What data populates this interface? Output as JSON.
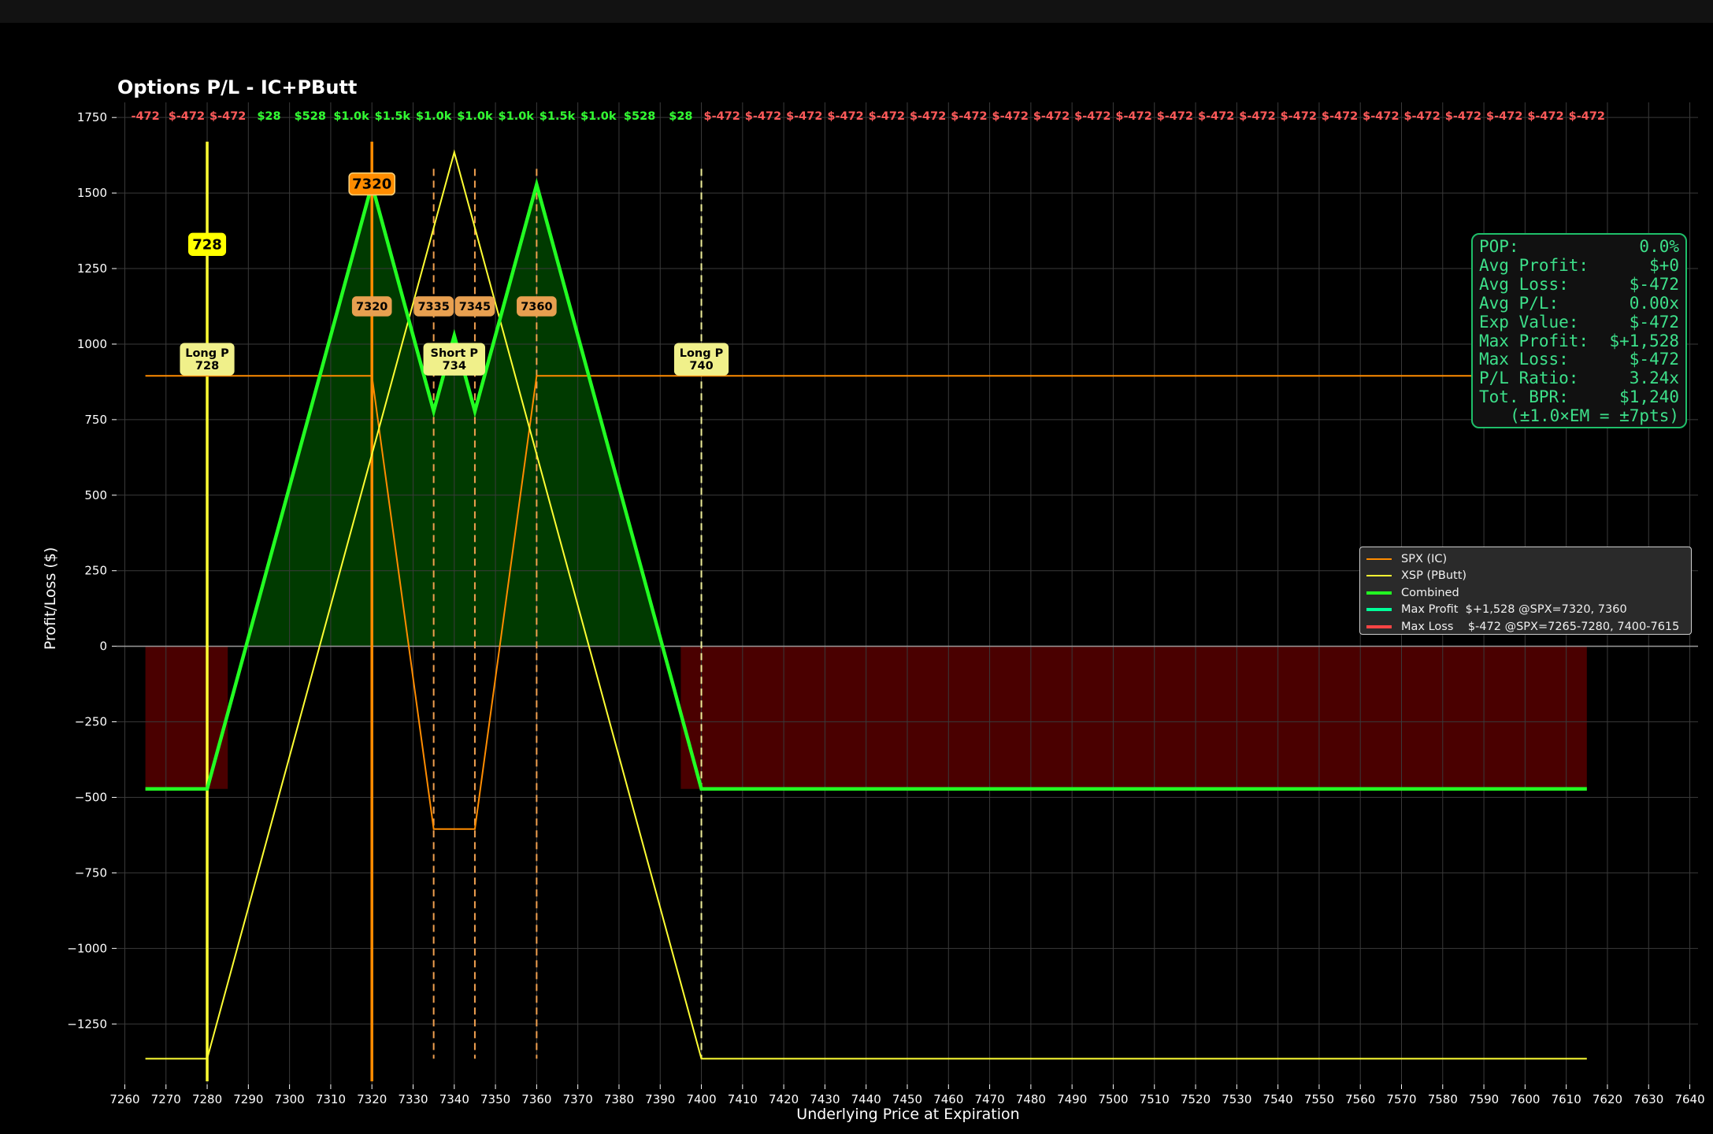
{
  "title": "Options P/L - IC+PButt",
  "chart_data": {
    "type": "line",
    "title": "Options P/L - IC+PButt",
    "xlabel": "Underlying Price at Expiration",
    "ylabel": "Profit/Loss ($)",
    "xlim": [
      7258,
      7642
    ],
    "ylim": [
      -1450,
      1800
    ],
    "xticks": [
      7260,
      7270,
      7280,
      7290,
      7300,
      7310,
      7320,
      7330,
      7340,
      7350,
      7360,
      7370,
      7380,
      7390,
      7400,
      7410,
      7420,
      7430,
      7440,
      7450,
      7460,
      7470,
      7480,
      7490,
      7500,
      7510,
      7520,
      7530,
      7540,
      7550,
      7560,
      7570,
      7580,
      7590,
      7600,
      7610,
      7620,
      7630,
      7640
    ],
    "xtick_labels": [
      "7260",
      "7270",
      "7280",
      "7290",
      "7300",
      "7310",
      "7320",
      "7330",
      "7340",
      "7350",
      "7360",
      "7370",
      "7380",
      "7390",
      "7400",
      "7410",
      "7420",
      "7430",
      "7440",
      "7450",
      "7460",
      "7470",
      "7480",
      "7490",
      "7500",
      "7510",
      "7520",
      "7530",
      "7540",
      "7550",
      "7560",
      "7570",
      "7580",
      "7590",
      "7600",
      "7610",
      "7620",
      "7630",
      "7640"
    ],
    "yticks": [
      -1250,
      -1000,
      -750,
      -500,
      -250,
      0,
      250,
      500,
      750,
      1000,
      1250,
      1500,
      1750
    ],
    "ytick_labels": [
      "−1250",
      "−1000",
      "−750",
      "−500",
      "−250",
      "0",
      "250",
      "500",
      "750",
      "1000",
      "1250",
      "1500",
      "1750"
    ],
    "grid": true,
    "legend_position": "right",
    "series": [
      {
        "name": "SPX (IC)",
        "color": "#ff8c00",
        "x": [
          7265,
          7320,
          7335,
          7345,
          7360,
          7615
        ],
        "y": [
          895,
          895,
          -605,
          -605,
          895,
          895
        ]
      },
      {
        "name": "XSP (PButt)",
        "color": "#ffff33",
        "x": [
          7265,
          7280,
          7340,
          7400,
          7615
        ],
        "y": [
          -1365,
          -1365,
          1635,
          -1365,
          -1365
        ]
      },
      {
        "name": "Combined",
        "color": "#22ff22",
        "x": [
          7265,
          7280,
          7320,
          7335,
          7340,
          7345,
          7360,
          7400,
          7615
        ],
        "y": [
          -472,
          -472,
          1528,
          778,
          1028,
          778,
          1528,
          -472,
          -472
        ]
      }
    ],
    "legend_entries": [
      {
        "label": "SPX (IC)",
        "color": "#ff8c00"
      },
      {
        "label": "XSP (PButt)",
        "color": "#ffff33"
      },
      {
        "label": "Combined",
        "color": "#22ff22"
      },
      {
        "label": "Max Profit  $+1,528 @SPX=7320, 7360",
        "color": "#00ff99"
      },
      {
        "label": "Max Loss    $-472 @SPX=7265-7280, 7400-7615",
        "color": "#ff4444"
      }
    ],
    "loss_zones": [
      [
        7265,
        7285
      ],
      [
        7395,
        7615
      ]
    ],
    "top_pl_labels": [
      {
        "x": 7265,
        "text": "-472",
        "color": "#ff5a5a"
      },
      {
        "x": 7275,
        "text": "$-472",
        "color": "#ff5a5a"
      },
      {
        "x": 7285,
        "text": "$-472",
        "color": "#ff5a5a"
      },
      {
        "x": 7295,
        "text": "$28",
        "color": "#33ff33"
      },
      {
        "x": 7305,
        "text": "$528",
        "color": "#33ff33"
      },
      {
        "x": 7315,
        "text": "$1.0k",
        "color": "#33ff33"
      },
      {
        "x": 7325,
        "text": "$1.5k",
        "color": "#33ff33"
      },
      {
        "x": 7335,
        "text": "$1.0k",
        "color": "#33ff33"
      },
      {
        "x": 7345,
        "text": "$1.0k",
        "color": "#33ff33"
      },
      {
        "x": 7355,
        "text": "$1.0k",
        "color": "#33ff33"
      },
      {
        "x": 7365,
        "text": "$1.5k",
        "color": "#33ff33"
      },
      {
        "x": 7375,
        "text": "$1.0k",
        "color": "#33ff33"
      },
      {
        "x": 7385,
        "text": "$528",
        "color": "#33ff33"
      },
      {
        "x": 7395,
        "text": "$28",
        "color": "#33ff33"
      },
      {
        "x": 7405,
        "text": "$-472",
        "color": "#ff5a5a"
      },
      {
        "x": 7415,
        "text": "$-472",
        "color": "#ff5a5a"
      },
      {
        "x": 7425,
        "text": "$-472",
        "color": "#ff5a5a"
      },
      {
        "x": 7435,
        "text": "$-472",
        "color": "#ff5a5a"
      },
      {
        "x": 7445,
        "text": "$-472",
        "color": "#ff5a5a"
      },
      {
        "x": 7455,
        "text": "$-472",
        "color": "#ff5a5a"
      },
      {
        "x": 7465,
        "text": "$-472",
        "color": "#ff5a5a"
      },
      {
        "x": 7475,
        "text": "$-472",
        "color": "#ff5a5a"
      },
      {
        "x": 7485,
        "text": "$-472",
        "color": "#ff5a5a"
      },
      {
        "x": 7495,
        "text": "$-472",
        "color": "#ff5a5a"
      },
      {
        "x": 7505,
        "text": "$-472",
        "color": "#ff5a5a"
      },
      {
        "x": 7515,
        "text": "$-472",
        "color": "#ff5a5a"
      },
      {
        "x": 7525,
        "text": "$-472",
        "color": "#ff5a5a"
      },
      {
        "x": 7535,
        "text": "$-472",
        "color": "#ff5a5a"
      },
      {
        "x": 7545,
        "text": "$-472",
        "color": "#ff5a5a"
      },
      {
        "x": 7555,
        "text": "$-472",
        "color": "#ff5a5a"
      },
      {
        "x": 7565,
        "text": "$-472",
        "color": "#ff5a5a"
      },
      {
        "x": 7575,
        "text": "$-472",
        "color": "#ff5a5a"
      },
      {
        "x": 7585,
        "text": "$-472",
        "color": "#ff5a5a"
      },
      {
        "x": 7595,
        "text": "$-472",
        "color": "#ff5a5a"
      },
      {
        "x": 7605,
        "text": "$-472",
        "color": "#ff5a5a"
      },
      {
        "x": 7615,
        "text": "$-472",
        "color": "#ff5a5a"
      }
    ],
    "strike_lines": [
      {
        "x": 7280,
        "color": "#ffff33",
        "style": "solid"
      },
      {
        "x": 7320,
        "color": "#ff8c00",
        "style": "solid"
      },
      {
        "x": 7335,
        "color": "#f0a050",
        "style": "dashed"
      },
      {
        "x": 7345,
        "color": "#f0a050",
        "style": "dashed"
      },
      {
        "x": 7360,
        "color": "#f0a050",
        "style": "dashed"
      },
      {
        "x": 7400,
        "color": "#eeee99",
        "style": "dashed"
      }
    ],
    "annotations": [
      {
        "x": 7280,
        "y": 1330,
        "text": "728",
        "bg": "#ffff00",
        "fg": "#000000",
        "border": "#ffff00",
        "lines": 1
      },
      {
        "x": 7320,
        "y": 1530,
        "text": "7320",
        "bg": "#ff8c00",
        "fg": "#000000",
        "border": "#ffd27a",
        "lines": 1
      },
      {
        "x": 7320,
        "y": 1125,
        "text": "7320",
        "bg": "#e8a050",
        "fg": "#000000",
        "border": "#e8a050",
        "lines": 1
      },
      {
        "x": 7335,
        "y": 1125,
        "text": "7335",
        "bg": "#e8a050",
        "fg": "#000000",
        "border": "#e8a050",
        "lines": 1
      },
      {
        "x": 7345,
        "y": 1125,
        "text": "7345",
        "bg": "#e8a050",
        "fg": "#000000",
        "border": "#e8a050",
        "lines": 1
      },
      {
        "x": 7360,
        "y": 1125,
        "text": "7360",
        "bg": "#e8a050",
        "fg": "#000000",
        "border": "#e8a050",
        "lines": 1
      },
      {
        "x": 7280,
        "y": 950,
        "text": "Long P\n728",
        "bg": "#f0f08a",
        "fg": "#000000",
        "border": "#f0f08a",
        "lines": 2
      },
      {
        "x": 7340,
        "y": 950,
        "text": "Short P\n734",
        "bg": "#f0f08a",
        "fg": "#000000",
        "border": "#f0f08a",
        "lines": 2
      },
      {
        "x": 7400,
        "y": 950,
        "text": "Long P\n740",
        "bg": "#f0f08a",
        "fg": "#000000",
        "border": "#f0f08a",
        "lines": 2
      }
    ]
  },
  "stats": {
    "rows": [
      {
        "label": "POP:",
        "value": "0.0%"
      },
      {
        "label": "Avg Profit:",
        "value": "$+0"
      },
      {
        "label": "Avg Loss:",
        "value": "$-472"
      },
      {
        "label": "Avg P/L:",
        "value": "0.00x"
      },
      {
        "label": "Exp Value:",
        "value": "$-472"
      },
      {
        "label": "Max Profit:",
        "value": "$+1,528"
      },
      {
        "label": "Max Loss:",
        "value": "$-472"
      },
      {
        "label": "P/L Ratio:",
        "value": "3.24x"
      },
      {
        "label": "Tot. BPR:",
        "value": "$1,240"
      }
    ],
    "note": "(±1.0×EM = ±7pts)"
  },
  "colors": {
    "background": "#000000",
    "grid": "#3a3a3a",
    "profit_fill": "#003a00",
    "loss_fill": "#4a0000",
    "stats_text": "#3de08a",
    "stats_border": "#1fbf6a"
  }
}
